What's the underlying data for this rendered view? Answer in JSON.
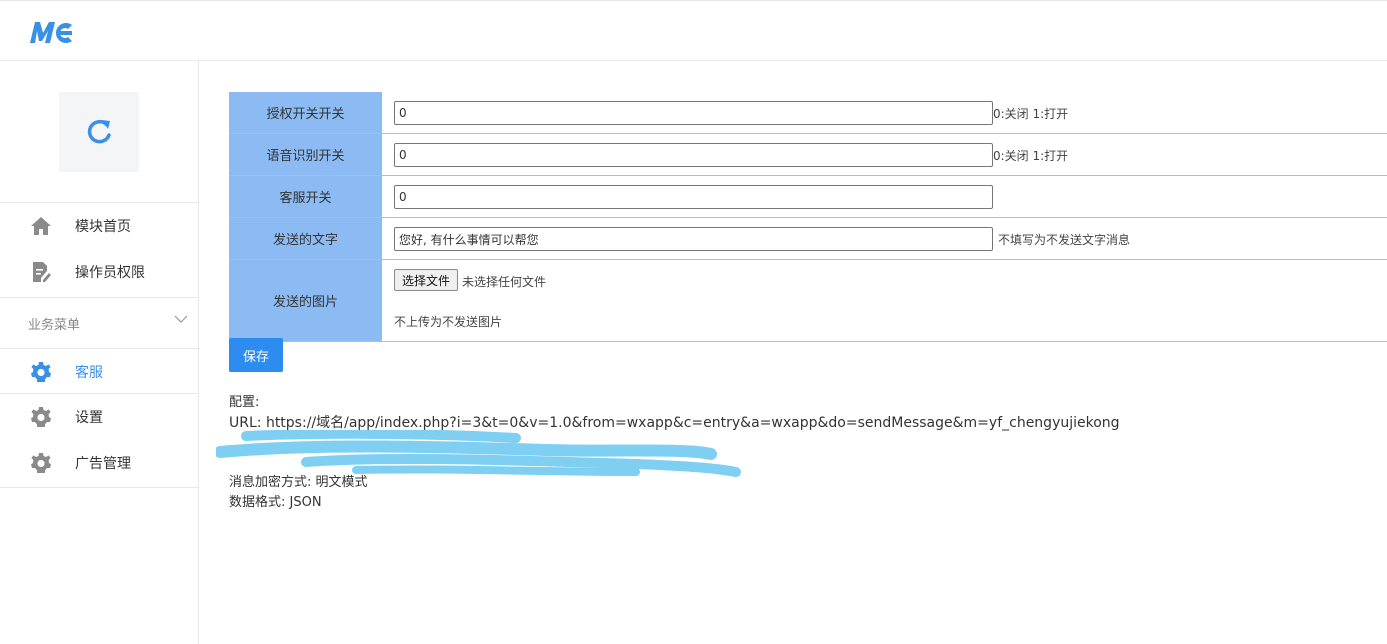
{
  "header": {
    "logo_text": "MC"
  },
  "sidebar": {
    "items": [
      {
        "label": "模块首页",
        "icon": "home-icon"
      },
      {
        "label": "操作员权限",
        "icon": "document-edit-icon"
      }
    ],
    "group": {
      "label": "业务菜单"
    },
    "menu": [
      {
        "label": "客服",
        "icon": "gear-icon",
        "active": true
      },
      {
        "label": "设置",
        "icon": "gear-icon"
      },
      {
        "label": "广告管理",
        "icon": "gear-icon"
      }
    ]
  },
  "form": {
    "rows": [
      {
        "label": "授权开关开关",
        "value": "0",
        "hint": "0:关闭 1:打开"
      },
      {
        "label": "语音识别开关",
        "value": "0",
        "hint": "0:关闭 1:打开"
      },
      {
        "label": "客服开关",
        "value": "0",
        "hint": ""
      },
      {
        "label": "发送的文字",
        "value": "您好, 有什么事情可以帮您",
        "hint": "不填写为不发送文字消息"
      }
    ],
    "image_row": {
      "label": "发送的图片",
      "button": "选择文件",
      "file_status": "未选择任何文件",
      "hint": "不上传为不发送图片"
    },
    "save": "保存"
  },
  "config": {
    "title": "配置:",
    "url": "URL: https://域名/app/index.php?i=3&t=0&v=1.0&from=wxapp&c=entry&a=wxapp&do=sendMessage&m=yf_chengyujiekong",
    "encrypt": "消息加密方式: 明文模式",
    "format": "数据格式: JSON"
  },
  "colors": {
    "accent": "#2d8cf0",
    "label_bg": "#8bbbf2",
    "redact": "#7fcff2"
  }
}
